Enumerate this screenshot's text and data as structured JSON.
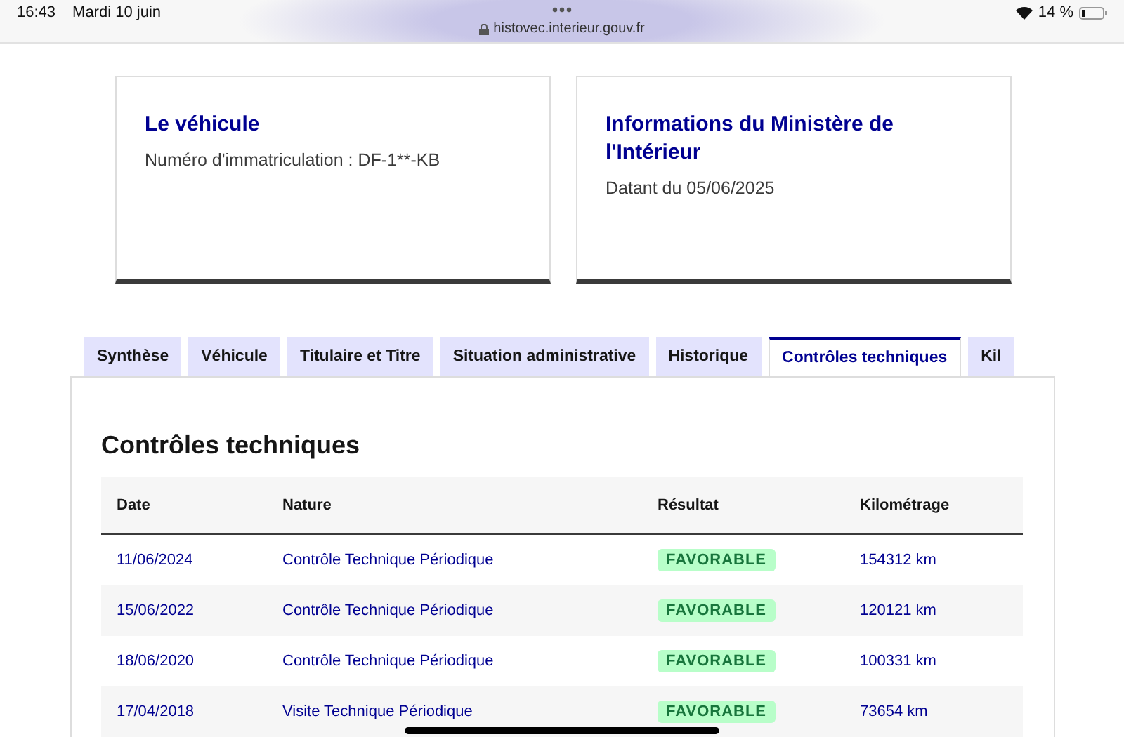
{
  "status_bar": {
    "time": "16:43",
    "date": "Mardi 10 juin",
    "url": "histovec.interieur.gouv.fr",
    "battery": "14 %"
  },
  "cards": [
    {
      "title": "Le véhicule",
      "text": "Numéro d'immatriculation : DF-1**-KB"
    },
    {
      "title": "Informations du Ministère de l'Intérieur",
      "text": "Datant du 05/06/2025"
    }
  ],
  "tabs": [
    {
      "label": "Synthèse",
      "selected": false
    },
    {
      "label": "Véhicule",
      "selected": false
    },
    {
      "label": "Titulaire et Titre",
      "selected": false
    },
    {
      "label": "Situation administrative",
      "selected": false
    },
    {
      "label": "Historique",
      "selected": false
    },
    {
      "label": "Contrôles techniques",
      "selected": true
    },
    {
      "label": "Kil",
      "selected": false
    }
  ],
  "section": {
    "title": "Contrôles techniques"
  },
  "table": {
    "columns": [
      "Date",
      "Nature",
      "Résultat",
      "Kilométrage"
    ],
    "rows": [
      {
        "date": "11/06/2024",
        "nature": "Contrôle Technique Périodique",
        "result": "FAVORABLE",
        "km": "154312 km"
      },
      {
        "date": "15/06/2022",
        "nature": "Contrôle Technique Périodique",
        "result": "FAVORABLE",
        "km": "120121 km"
      },
      {
        "date": "18/06/2020",
        "nature": "Contrôle Technique Périodique",
        "result": "FAVORABLE",
        "km": "100331 km"
      },
      {
        "date": "17/04/2018",
        "nature": "Visite Technique Périodique",
        "result": "FAVORABLE",
        "km": "73654 km"
      }
    ]
  }
}
